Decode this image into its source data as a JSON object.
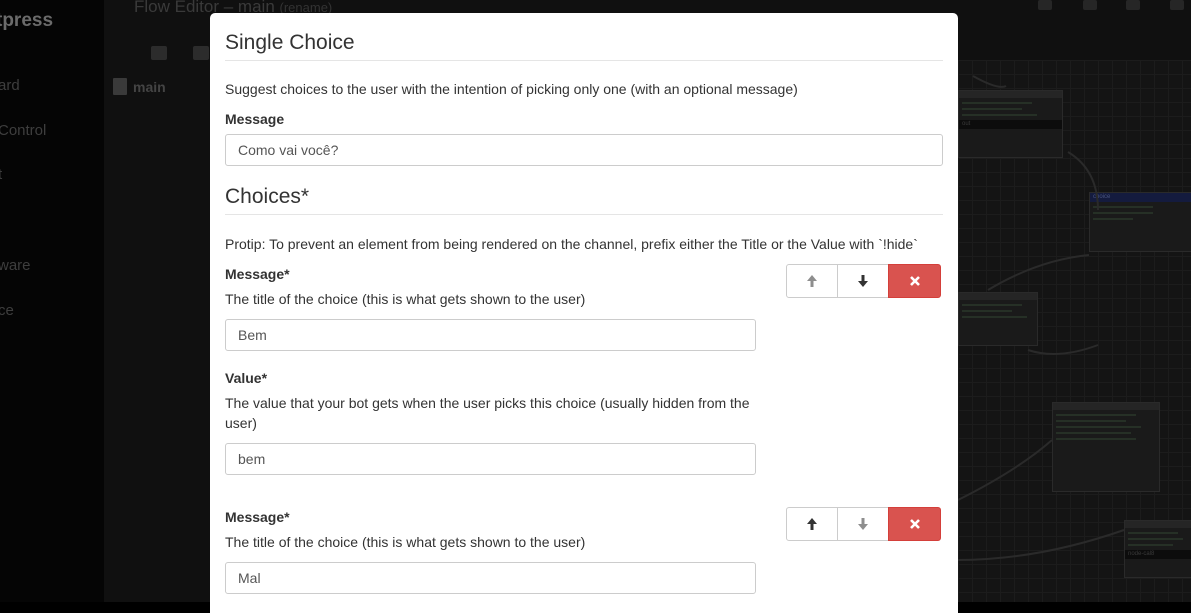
{
  "background": {
    "brand": "tpress",
    "sidebar_items": [
      "ard",
      "Control",
      "t",
      "ware",
      "ce"
    ],
    "editor_title": "Flow Editor – main",
    "rename_link": "(rename)",
    "flow_name": "main",
    "node_labels": [
      "out",
      "choice",
      "node-cal8"
    ],
    "colors": {
      "overlay": "#000000",
      "node_blue": "#141b3e"
    }
  },
  "modal": {
    "title": "Single Choice",
    "description": "Suggest choices to the user with the intention of picking only one (with an optional message)",
    "message_label": "Message",
    "message_value": "Como vai você?",
    "choices_title": "Choices*",
    "protip": "Protip: To prevent an element from being rendered on the channel, prefix either the Title or the Value with `!hide`",
    "choices": [
      {
        "title_label": "Message*",
        "title_help": "The title of the choice (this is what gets shown to the user)",
        "title_value": "Bem",
        "value_label": "Value*",
        "value_help_line1": "The value that your bot gets when the user picks this choice (usually hidden from the",
        "value_help_line2": "user)",
        "value_value": "bem",
        "move_up_enabled": false,
        "move_down_enabled": true
      },
      {
        "title_label": "Message*",
        "title_help": "The title of the choice (this is what gets shown to the user)",
        "title_value": "Mal",
        "move_up_enabled": true,
        "move_down_enabled": false
      }
    ],
    "icons": {
      "up": "arrow-up-icon",
      "down": "arrow-down-icon",
      "remove": "remove-icon"
    },
    "colors": {
      "danger": "#d9534f",
      "border": "#cccccc",
      "text": "#333333"
    }
  }
}
